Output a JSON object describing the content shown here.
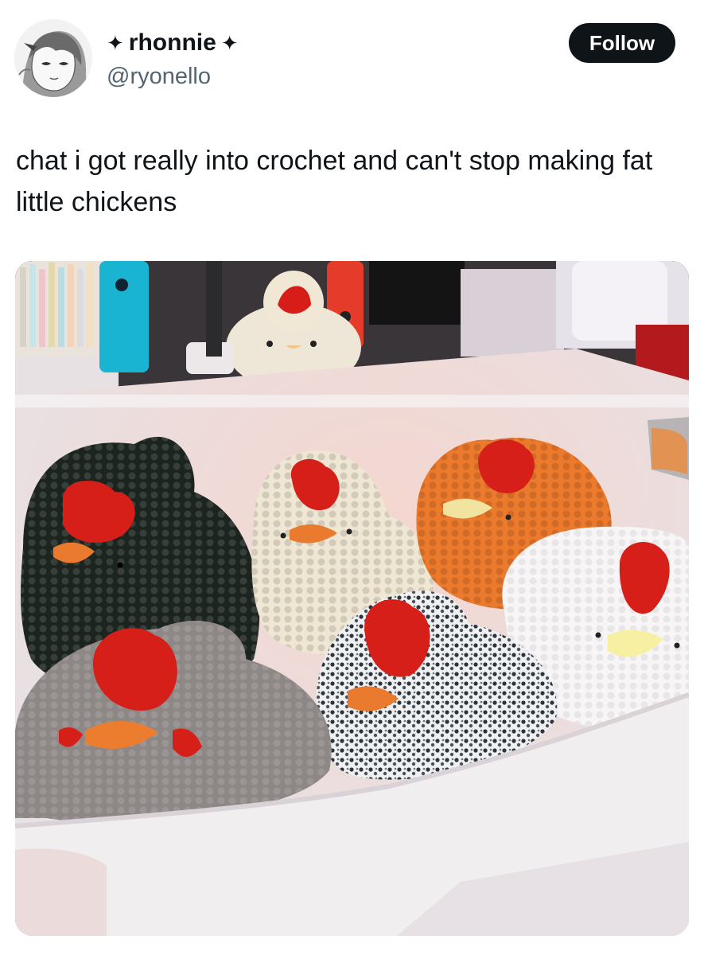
{
  "author": {
    "display_name": "rhonnie",
    "name_prefix_glyph": "✦",
    "name_suffix_glyph": "✦",
    "handle": "@ryonello",
    "avatar_icon": "anime-girl-avatar-icon"
  },
  "actions": {
    "follow_label": "Follow"
  },
  "tweet": {
    "text": "chat i got really into crochet and can't stop making fat little chickens"
  },
  "media": {
    "icon": "crochet-chickens-photo",
    "colors": {
      "black_chicken": "#1c2420",
      "cream_chicken": "#efe7d4",
      "orange_chicken": "#ec7a2c",
      "white_chicken": "#f7f5f6",
      "gray_chicken": "#8d8786",
      "speckled_chicken": "#3a3d44",
      "comb_red": "#d51f18",
      "beak_orange": "#e97a2e",
      "bin_white": "#eeeaee"
    }
  }
}
